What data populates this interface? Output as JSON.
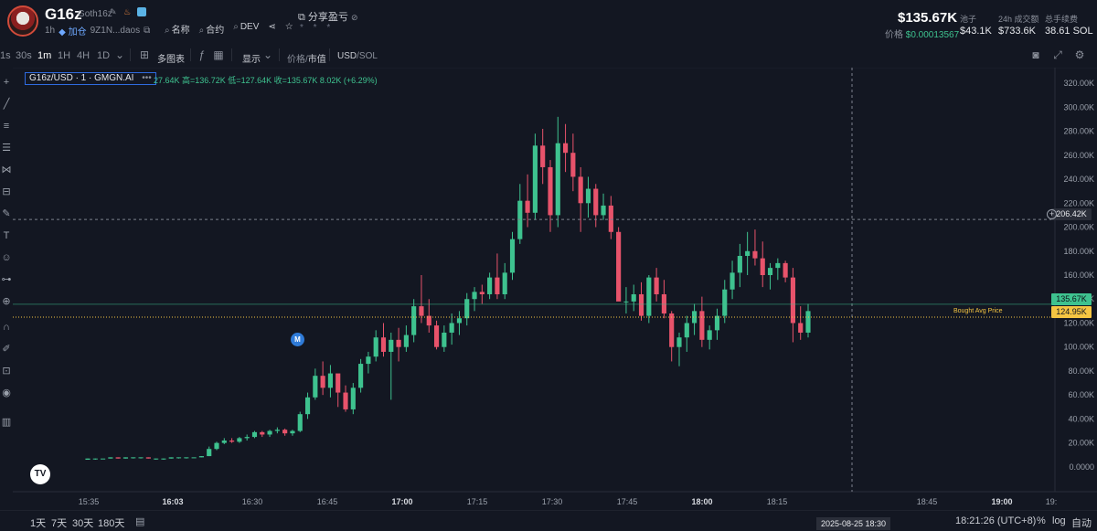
{
  "header": {
    "title": "G16z",
    "handle": "Goth16z",
    "age": "1h",
    "add_label": "加仓",
    "address": "9Z1N...daos",
    "links": [
      {
        "label": "名称",
        "icon": "search-icon"
      },
      {
        "label": "合约",
        "icon": "search-icon"
      },
      {
        "label": "DEV",
        "icon": "search-icon"
      }
    ],
    "share_label": "分享盈亏",
    "stars": "* * *",
    "price": "$135.67K",
    "price_label": "价格",
    "price_value": "$0.00013567",
    "stats": [
      {
        "label": "池子",
        "value": "$43.1K"
      },
      {
        "label": "24h 成交额",
        "value": "$733.6K"
      },
      {
        "label": "总手续费",
        "value": "38.61 SOL"
      }
    ]
  },
  "toolbar": {
    "timeframes": [
      "1s",
      "30s",
      "1m",
      "1H",
      "4H",
      "1D"
    ],
    "active_timeframe": "1m",
    "multi_chart": "多图表",
    "display": "显示",
    "price_label": "价格",
    "marketcap_label": "市值",
    "usd": "USD",
    "sol": "SOL"
  },
  "legend": {
    "symbol": "G16z/USD · 1 · GMGN.AI",
    "ohlc": "27.64K  高=136.72K  低=127.64K  收=135.67K  8.02K (+6.29%)"
  },
  "marker": {
    "label": "M"
  },
  "price_tags": {
    "crosshair": "206.42K",
    "current": "135.67K",
    "bought": "124.95K",
    "bought_label": "Bought Avg Price"
  },
  "crosshair_time": "2025-08-25  18:30",
  "bottom": {
    "ranges": [
      "1天",
      "7天",
      "30天",
      "180天"
    ],
    "clock": "18:21:26 (UTC+8)",
    "percent": "%",
    "log": "log",
    "auto": "自动"
  },
  "chart_data": {
    "type": "candlestick",
    "y_unit": "K",
    "ylim": [
      -10,
      330
    ],
    "yticks": [
      0,
      20,
      40,
      60,
      80,
      100,
      120,
      140,
      160,
      180,
      200,
      220,
      240,
      260,
      280,
      300,
      320
    ],
    "ytick_labels": [
      "0.0000",
      "20.00K",
      "40.00K",
      "60.00K",
      "80.00K",
      "100.00K",
      "120.00K",
      "140.00K",
      "160.00K",
      "180.00K",
      "200.00K",
      "220.00K",
      "240.00K",
      "260.00K",
      "280.00K",
      "300.00K",
      "320.00K"
    ],
    "xticks": [
      "15:35",
      "16:03",
      "16:30",
      "16:45",
      "17:00",
      "17:15",
      "17:30",
      "17:45",
      "18:00",
      "18:15",
      "18:45",
      "19:00",
      "19:"
    ],
    "bold_xticks": [
      "16:03",
      "17:00",
      "18:00",
      "19:00"
    ],
    "candles": [
      [
        6,
        7,
        6,
        7
      ],
      [
        7,
        7,
        6,
        7
      ],
      [
        7,
        7,
        7,
        7
      ],
      [
        7,
        8,
        7,
        8
      ],
      [
        8,
        8,
        7,
        7
      ],
      [
        7,
        8,
        7,
        8
      ],
      [
        8,
        8,
        7,
        8
      ],
      [
        8,
        8,
        7,
        8
      ],
      [
        8,
        8,
        7,
        7
      ],
      [
        7,
        7,
        6,
        7
      ],
      [
        7,
        7,
        6,
        7
      ],
      [
        7,
        8,
        7,
        8
      ],
      [
        8,
        8,
        7,
        8
      ],
      [
        8,
        8,
        7,
        8
      ],
      [
        8,
        8,
        8,
        8
      ],
      [
        8,
        9,
        8,
        9
      ],
      [
        9,
        17,
        9,
        15
      ],
      [
        15,
        21,
        14,
        20
      ],
      [
        20,
        24,
        19,
        22
      ],
      [
        22,
        24,
        20,
        21
      ],
      [
        21,
        25,
        20,
        24
      ],
      [
        24,
        27,
        22,
        25
      ],
      [
        25,
        30,
        24,
        29
      ],
      [
        29,
        30,
        25,
        27
      ],
      [
        27,
        31,
        25,
        30
      ],
      [
        30,
        33,
        28,
        31
      ],
      [
        31,
        32,
        26,
        28
      ],
      [
        28,
        31,
        26,
        30
      ],
      [
        30,
        46,
        29,
        44
      ],
      [
        44,
        62,
        40,
        58
      ],
      [
        58,
        82,
        56,
        76
      ],
      [
        76,
        88,
        60,
        66
      ],
      [
        66,
        85,
        58,
        78
      ],
      [
        78,
        72,
        50,
        62
      ],
      [
        62,
        68,
        46,
        48
      ],
      [
        48,
        70,
        44,
        66
      ],
      [
        66,
        90,
        62,
        86
      ],
      [
        86,
        96,
        78,
        92
      ],
      [
        92,
        114,
        88,
        108
      ],
      [
        108,
        120,
        92,
        96
      ],
      [
        96,
        112,
        56,
        106
      ],
      [
        106,
        116,
        88,
        100
      ],
      [
        100,
        118,
        96,
        110
      ],
      [
        110,
        140,
        104,
        134
      ],
      [
        134,
        160,
        120,
        126
      ],
      [
        126,
        140,
        112,
        118
      ],
      [
        118,
        122,
        98,
        100
      ],
      [
        100,
        118,
        96,
        112
      ],
      [
        112,
        128,
        102,
        120
      ],
      [
        120,
        130,
        110,
        124
      ],
      [
        124,
        145,
        118,
        140
      ],
      [
        140,
        150,
        130,
        146
      ],
      [
        146,
        152,
        136,
        144
      ],
      [
        144,
        162,
        140,
        158
      ],
      [
        158,
        178,
        140,
        144
      ],
      [
        144,
        170,
        140,
        162
      ],
      [
        162,
        196,
        156,
        190
      ],
      [
        190,
        236,
        186,
        222
      ],
      [
        222,
        244,
        200,
        212
      ],
      [
        212,
        278,
        206,
        268
      ],
      [
        268,
        282,
        236,
        250
      ],
      [
        250,
        256,
        196,
        210
      ],
      [
        210,
        292,
        200,
        270
      ],
      [
        270,
        286,
        246,
        262
      ],
      [
        262,
        278,
        230,
        242
      ],
      [
        242,
        250,
        196,
        220
      ],
      [
        220,
        242,
        208,
        232
      ],
      [
        232,
        236,
        200,
        210
      ],
      [
        210,
        228,
        206,
        218
      ],
      [
        218,
        226,
        190,
        196
      ],
      [
        196,
        200,
        144,
        138
      ],
      [
        138,
        150,
        128,
        138
      ],
      [
        138,
        152,
        130,
        144
      ],
      [
        144,
        154,
        122,
        126
      ],
      [
        126,
        160,
        120,
        158
      ],
      [
        158,
        166,
        138,
        144
      ],
      [
        144,
        156,
        124,
        128
      ],
      [
        128,
        130,
        88,
        100
      ],
      [
        100,
        112,
        84,
        108
      ],
      [
        108,
        126,
        96,
        120
      ],
      [
        120,
        136,
        110,
        130
      ],
      [
        130,
        142,
        100,
        106
      ],
      [
        106,
        118,
        98,
        114
      ],
      [
        114,
        132,
        106,
        126
      ],
      [
        126,
        156,
        120,
        148
      ],
      [
        148,
        172,
        140,
        162
      ],
      [
        162,
        186,
        150,
        176
      ],
      [
        176,
        196,
        160,
        180
      ],
      [
        180,
        198,
        168,
        174
      ],
      [
        174,
        188,
        150,
        160
      ],
      [
        160,
        170,
        148,
        166
      ],
      [
        166,
        174,
        156,
        170
      ],
      [
        170,
        172,
        154,
        158
      ],
      [
        158,
        166,
        104,
        120
      ],
      [
        120,
        134,
        106,
        112
      ],
      [
        112,
        136,
        108,
        130
      ]
    ]
  }
}
